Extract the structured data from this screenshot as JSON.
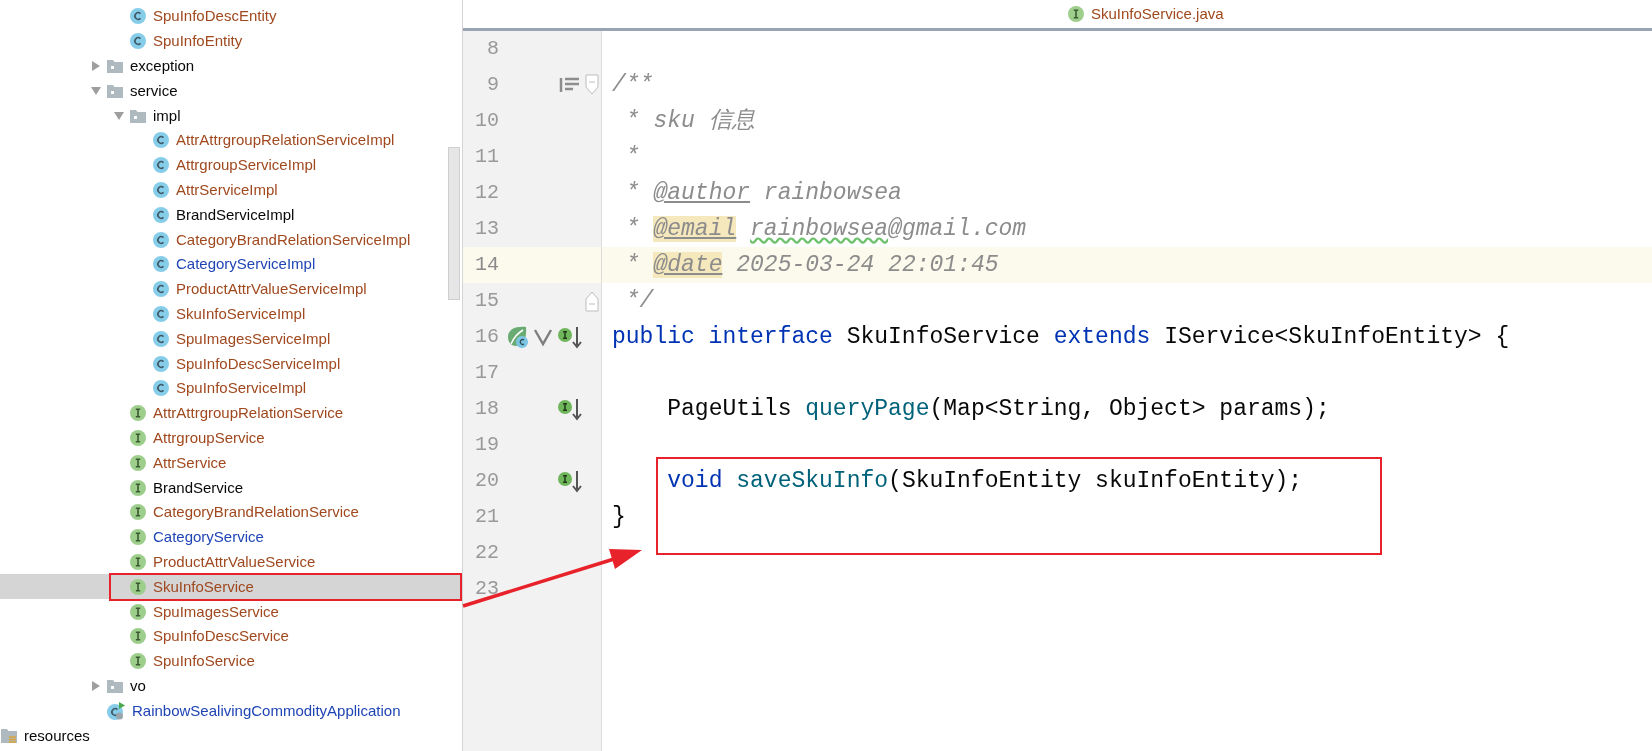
{
  "project_tree": {
    "continued_items": [
      {
        "label": "SpuInfoDescEntity",
        "kind": "class",
        "color": "#a0481e",
        "selected": false,
        "boxed": false
      },
      {
        "label": "SpuInfoEntity",
        "kind": "class",
        "color": "#a0481e",
        "selected": false,
        "boxed": false
      }
    ],
    "items": [
      {
        "label": "exception",
        "kind": "folder",
        "expanded": false,
        "color": "#080808",
        "selected": false,
        "boxed": false
      },
      {
        "label": "service",
        "kind": "folder",
        "expanded": true,
        "color": "#080808",
        "selected": false,
        "boxed": false,
        "children": [
          {
            "label": "impl",
            "kind": "folder",
            "expanded": true,
            "color": "#080808",
            "selected": false,
            "boxed": false,
            "children": [
              {
                "label": "AttrAttrgroupRelationServiceImpl",
                "kind": "class",
                "color": "#a0481e",
                "selected": false,
                "boxed": false
              },
              {
                "label": "AttrgroupServiceImpl",
                "kind": "class",
                "color": "#a0481e",
                "selected": false,
                "boxed": false
              },
              {
                "label": "AttrServiceImpl",
                "kind": "class",
                "color": "#a0481e",
                "selected": false,
                "boxed": false
              },
              {
                "label": "BrandServiceImpl",
                "kind": "class",
                "color": "#080808",
                "selected": false,
                "boxed": false
              },
              {
                "label": "CategoryBrandRelationServiceImpl",
                "kind": "class",
                "color": "#a0481e",
                "selected": false,
                "boxed": false
              },
              {
                "label": "CategoryServiceImpl",
                "kind": "class",
                "color": "#1f45b5",
                "selected": false,
                "boxed": false
              },
              {
                "label": "ProductAttrValueServiceImpl",
                "kind": "class",
                "color": "#a0481e",
                "selected": false,
                "boxed": false
              },
              {
                "label": "SkuInfoServiceImpl",
                "kind": "class",
                "color": "#a0481e",
                "selected": false,
                "boxed": false
              },
              {
                "label": "SpuImagesServiceImpl",
                "kind": "class",
                "color": "#a0481e",
                "selected": false,
                "boxed": false
              },
              {
                "label": "SpuInfoDescServiceImpl",
                "kind": "class",
                "color": "#a0481e",
                "selected": false,
                "boxed": false
              },
              {
                "label": "SpuInfoServiceImpl",
                "kind": "class",
                "color": "#a0481e",
                "selected": false,
                "boxed": false
              }
            ]
          },
          {
            "label": "AttrAttrgroupRelationService",
            "kind": "interface",
            "color": "#a0481e",
            "selected": false,
            "boxed": false
          },
          {
            "label": "AttrgroupService",
            "kind": "interface",
            "color": "#a0481e",
            "selected": false,
            "boxed": false
          },
          {
            "label": "AttrService",
            "kind": "interface",
            "color": "#a0481e",
            "selected": false,
            "boxed": false
          },
          {
            "label": "BrandService",
            "kind": "interface",
            "color": "#080808",
            "selected": false,
            "boxed": false
          },
          {
            "label": "CategoryBrandRelationService",
            "kind": "interface",
            "color": "#a0481e",
            "selected": false,
            "boxed": false
          },
          {
            "label": "CategoryService",
            "kind": "interface",
            "color": "#1f45b5",
            "selected": false,
            "boxed": false
          },
          {
            "label": "ProductAttrValueService",
            "kind": "interface",
            "color": "#a0481e",
            "selected": false,
            "boxed": false
          },
          {
            "label": "SkuInfoService",
            "kind": "interface",
            "color": "#a0481e",
            "selected": true,
            "boxed": true
          },
          {
            "label": "SpuImagesService",
            "kind": "interface",
            "color": "#a0481e",
            "selected": false,
            "boxed": false
          },
          {
            "label": "SpuInfoDescService",
            "kind": "interface",
            "color": "#a0481e",
            "selected": false,
            "boxed": false
          },
          {
            "label": "SpuInfoService",
            "kind": "interface",
            "color": "#a0481e",
            "selected": false,
            "boxed": false
          }
        ]
      },
      {
        "label": "vo",
        "kind": "folder",
        "expanded": false,
        "color": "#080808",
        "selected": false,
        "boxed": false
      },
      {
        "label": "RainbowSealivingCommodityApplication",
        "kind": "app_class",
        "color": "#1f45b5",
        "selected": false,
        "boxed": false
      }
    ],
    "root_items": [
      {
        "label": "resources",
        "kind": "resources_folder",
        "color": "#080808",
        "selected": false,
        "boxed": false
      }
    ]
  },
  "tabs": [
    {
      "label": "SkuInfoService.java",
      "kind": "interface",
      "color": "#a0481e"
    }
  ],
  "editor": {
    "lines": [
      {
        "number": "8",
        "current": false,
        "boxed": false
      },
      {
        "number": "9",
        "current": false,
        "boxed": false,
        "gutter_icons": [
          {
            "kind": "lines"
          }
        ],
        "fold_marker": {
          "kind": "start"
        },
        "tokens": [
          {
            "text": "/**",
            "kind": "comment"
          }
        ]
      },
      {
        "number": "10",
        "current": false,
        "boxed": false,
        "tokens": [
          {
            "text": " * sku 信息",
            "kind": "comment"
          }
        ]
      },
      {
        "number": "11",
        "current": false,
        "boxed": false,
        "tokens": [
          {
            "text": " *",
            "kind": "comment"
          }
        ]
      },
      {
        "number": "12",
        "current": false,
        "boxed": false,
        "tokens": [
          {
            "text": " * ",
            "kind": "comment"
          },
          {
            "text": "@author",
            "kind": "doc_tag"
          },
          {
            "text": " rainbowsea",
            "kind": "comment"
          }
        ]
      },
      {
        "number": "13",
        "current": false,
        "boxed": false,
        "tokens": [
          {
            "text": " * ",
            "kind": "comment"
          },
          {
            "text": "@email",
            "kind": "doc_tag_match"
          },
          {
            "text": " rainbowsea",
            "kind": "typo"
          },
          {
            "text": "@gmail.com",
            "kind": "comment"
          }
        ]
      },
      {
        "number": "14",
        "current": true,
        "boxed": false,
        "tokens": [
          {
            "text": " * ",
            "kind": "comment"
          },
          {
            "text": "@date",
            "kind": "doc_tag_match"
          },
          {
            "text": " 2025-03-24 22:01:45",
            "kind": "comment"
          }
        ]
      },
      {
        "number": "15",
        "current": false,
        "boxed": false,
        "fold_marker": {
          "kind": "end"
        },
        "tokens": [
          {
            "text": " */",
            "kind": "comment"
          }
        ]
      },
      {
        "number": "16",
        "current": false,
        "boxed": false,
        "gutter_icons": [
          {
            "kind": "bean"
          },
          {
            "kind": "check"
          },
          {
            "kind": "implemented"
          }
        ],
        "tokens": [
          {
            "text": "public interface",
            "kind": "keyword"
          },
          {
            "text": " SkuInfoService ",
            "kind": "plain"
          },
          {
            "text": "extends",
            "kind": "keyword"
          },
          {
            "text": " IService<SkuInfoEntity> {",
            "kind": "plain"
          }
        ]
      },
      {
        "number": "17",
        "current": false,
        "boxed": false
      },
      {
        "number": "18",
        "current": false,
        "boxed": false,
        "gutter_icons": [
          {
            "kind": "implemented"
          }
        ],
        "tokens": [
          {
            "text": "    PageUtils ",
            "kind": "plain"
          },
          {
            "text": "queryPage",
            "kind": "method"
          },
          {
            "text": "(Map<String, Object> params);",
            "kind": "plain"
          }
        ]
      },
      {
        "number": "19",
        "current": false,
        "boxed": false
      },
      {
        "number": "20",
        "current": false,
        "boxed": true,
        "gutter_icons": [
          {
            "kind": "implemented"
          }
        ],
        "tokens": [
          {
            "text": "    void",
            "kind": "keyword"
          },
          {
            "text": " saveSkuInfo",
            "kind": "method"
          },
          {
            "text": "(SkuInfoEntity skuInfoEntity);",
            "kind": "plain"
          }
        ]
      },
      {
        "number": "21",
        "current": false,
        "boxed": false,
        "tokens": [
          {
            "text": "}",
            "kind": "plain"
          }
        ]
      },
      {
        "number": "22",
        "current": false,
        "boxed": false
      },
      {
        "number": "23",
        "current": false,
        "boxed": false
      }
    ]
  },
  "annotation_arrow": true
}
